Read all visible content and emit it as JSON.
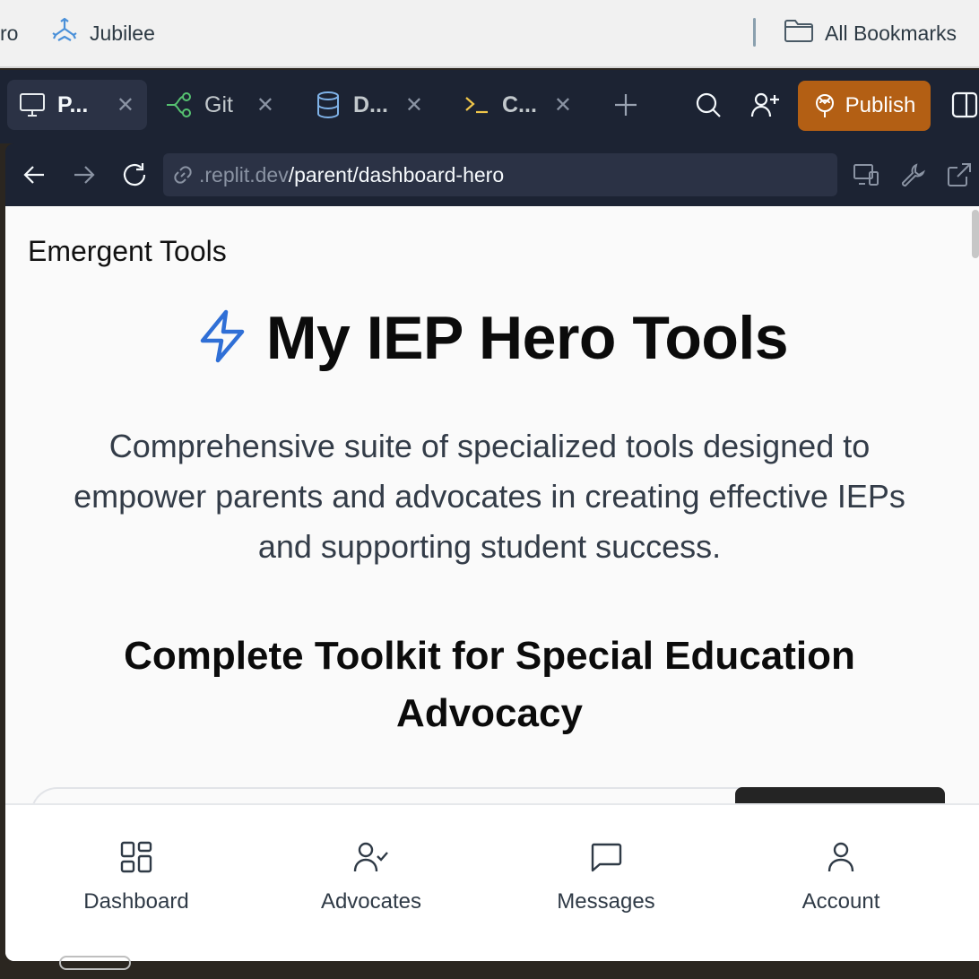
{
  "bookmarks": {
    "partial_label": "ro",
    "jubilee_label": "Jubilee",
    "all_bookmarks_label": "All Bookmarks"
  },
  "tabs": [
    {
      "label": "P...",
      "icon": "monitor-icon",
      "active": true
    },
    {
      "label": "Git",
      "icon": "git-branch-icon",
      "active": false
    },
    {
      "label": "D...",
      "icon": "database-icon",
      "active": false
    },
    {
      "label": "C...",
      "icon": "terminal-icon",
      "active": false
    }
  ],
  "toolbar": {
    "publish_label": "Publish"
  },
  "browser": {
    "url_host": ".replit.dev",
    "url_path": "/parent/dashboard-hero"
  },
  "page": {
    "brand": "Emergent Tools",
    "hero_title": "My IEP Hero Tools",
    "hero_description": "Comprehensive suite of specialized tools designed to empower parents and advocates in creating effective IEPs and supporting student success.",
    "section_title": "Complete Toolkit for Special Education Advocacy"
  },
  "bottom_nav": [
    {
      "label": "Dashboard",
      "icon": "dashboard-grid-icon"
    },
    {
      "label": "Advocates",
      "icon": "user-check-icon"
    },
    {
      "label": "Messages",
      "icon": "message-icon"
    },
    {
      "label": "Account",
      "icon": "user-icon"
    }
  ],
  "colors": {
    "accent_lightning": "#2f6fd6",
    "publish_bg": "#b35f14",
    "topbar_bg": "#1c2333"
  }
}
